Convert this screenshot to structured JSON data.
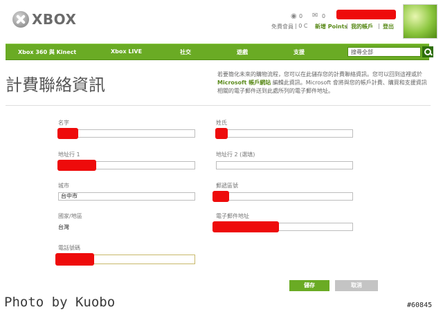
{
  "header": {
    "logo_text": "XBOX",
    "gold_count": "0",
    "mail_count": "0",
    "membership": "免費會員",
    "points_separator": "| 0 C",
    "ms_points": "新增 Points",
    "my_account": "我的帳戶",
    "sign_out": "登出",
    "separator": "|"
  },
  "nav": {
    "items": [
      "Xbox 360 與 Kinect",
      "Xbox LIVE",
      "社交",
      "遊戲",
      "支援"
    ],
    "search_placeholder": "搜尋全部"
  },
  "page": {
    "title": "計費聯絡資訊",
    "description_pre": "若要簡化未來的購物流程，您可以在此儲存您的計費聯絡資訊。您可以回到這裡或於",
    "description_link": "Microsoft 帳戶網站",
    "description_post": "編輯此資訊。Microsoft 會將與您的帳戶計費、購買和支援資訊相關的電子郵件送到此處所列的電子郵件地址。"
  },
  "form": {
    "first_name_label": "名字",
    "last_name_label": "姓氏",
    "address1_label": "地址行 1",
    "address2_label": "地址行 2 (選填)",
    "city_label": "城市",
    "city_value": "台中市",
    "postal_label": "郵遞區號",
    "country_label": "國家/地區",
    "country_value": "台灣",
    "email_label": "電子郵件地址",
    "phone_label": "電話號碼",
    "save_label": "儲存",
    "cancel_label": "取消"
  },
  "watermark": {
    "credit": "Photo by Kuobo",
    "id": "#60845"
  },
  "colors": {
    "nav_green": "#6aab24",
    "link_green": "#5a8a1a",
    "redaction": "#ee0b0b",
    "save_button": "#6aab24",
    "cancel_button": "#c4c4c4"
  }
}
